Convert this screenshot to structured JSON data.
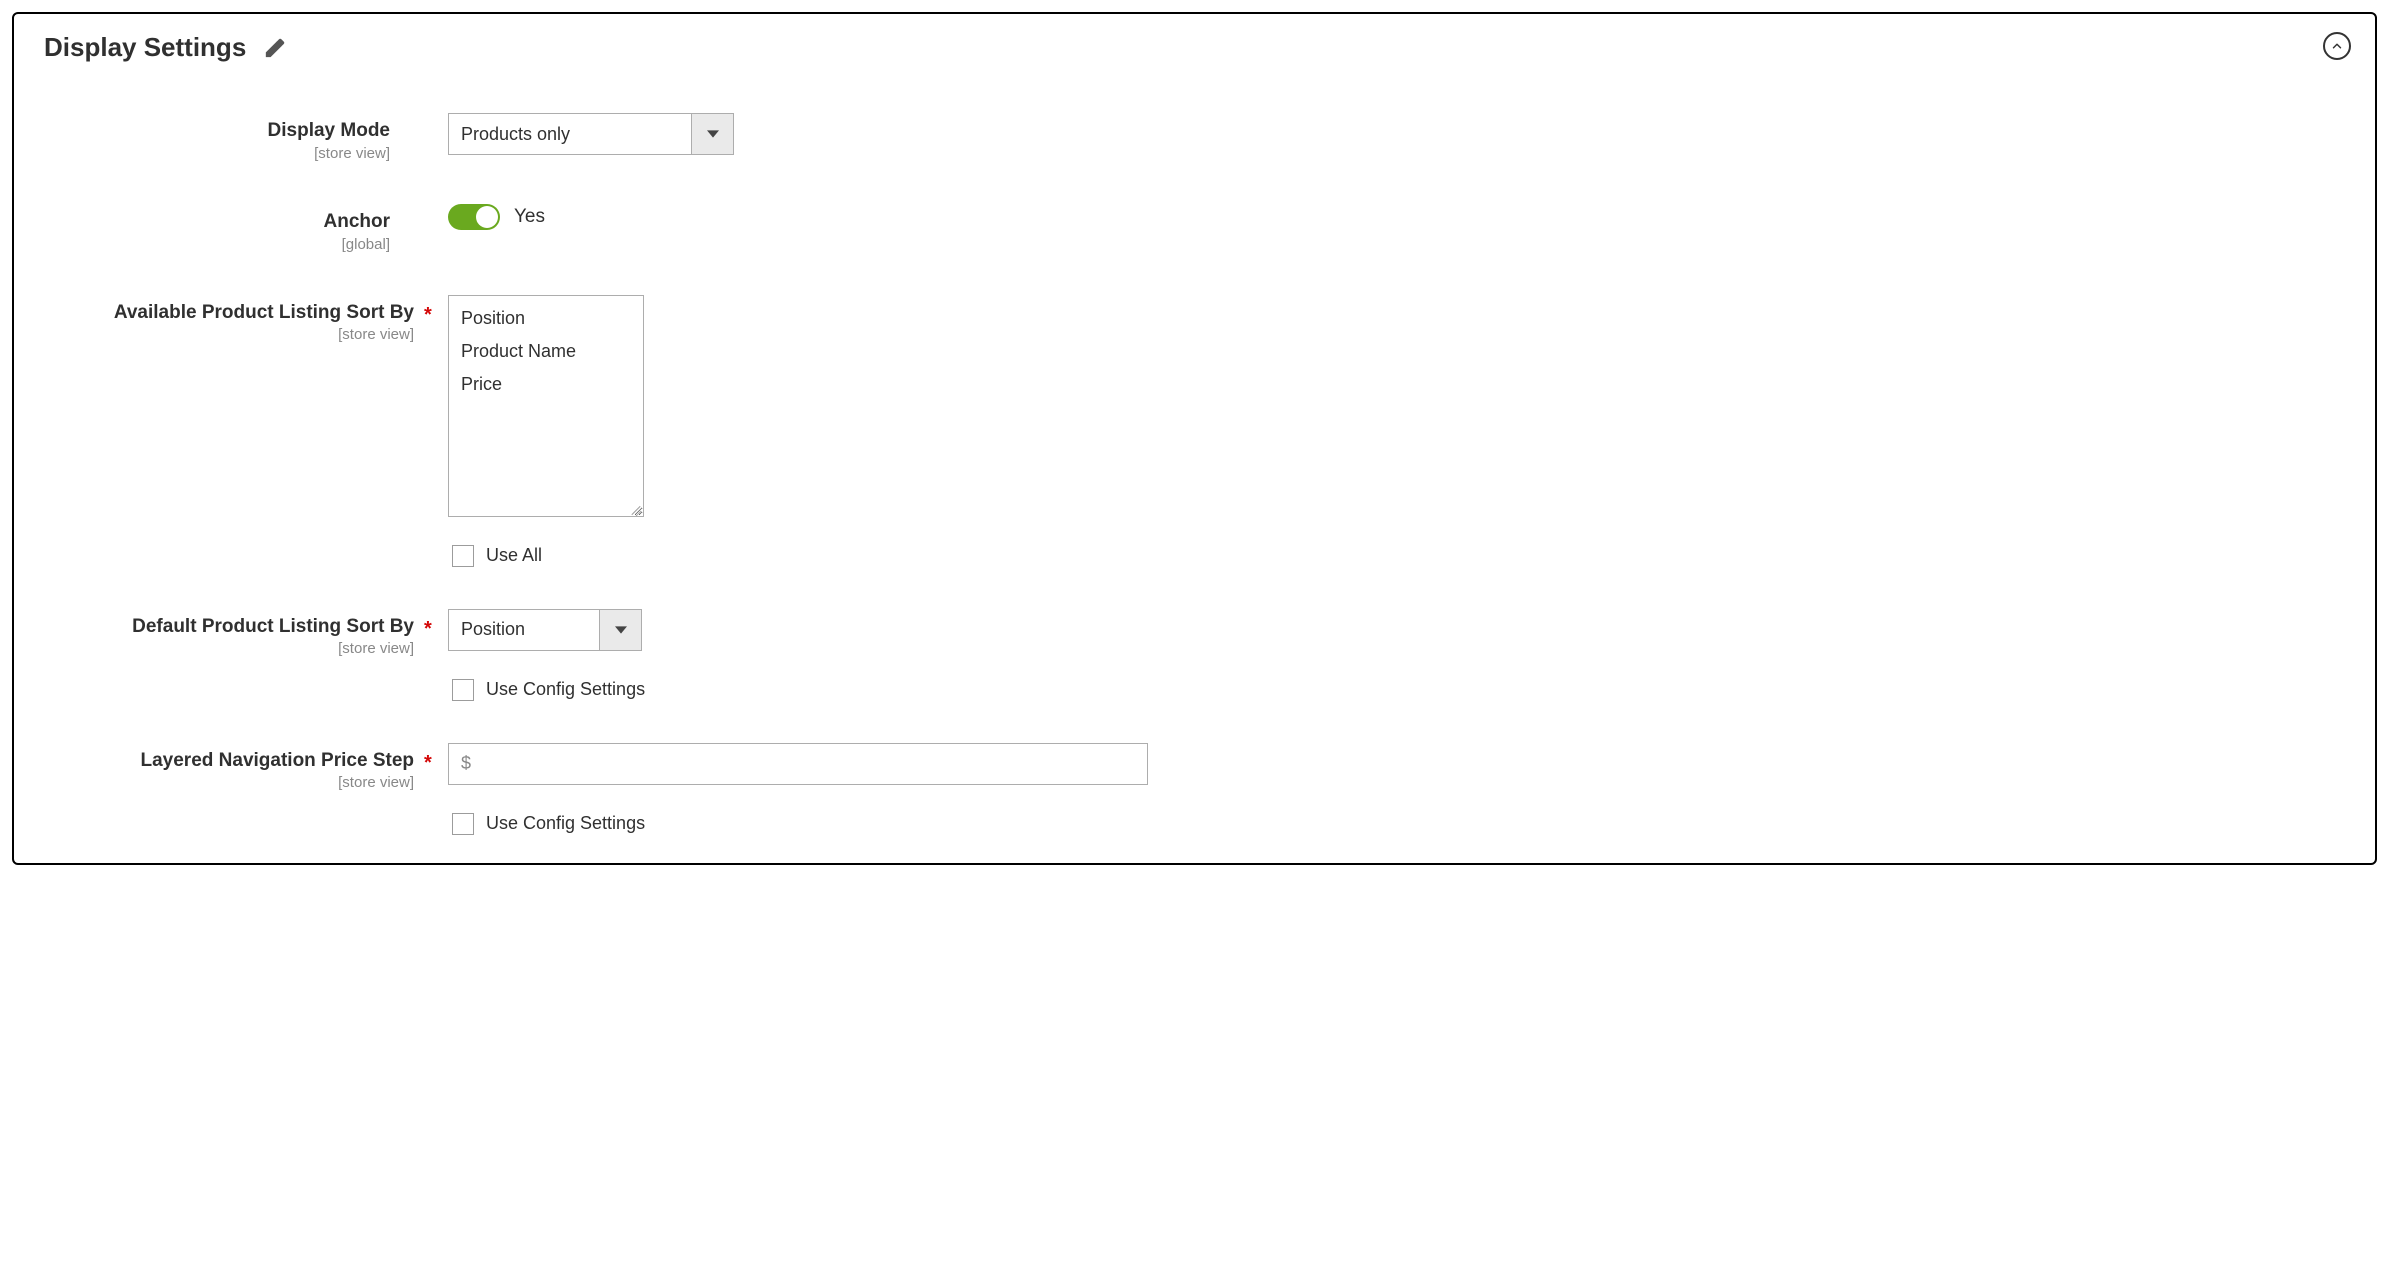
{
  "section": {
    "title": "Display Settings"
  },
  "scopes": {
    "store_view": "[store view]",
    "global": "[global]"
  },
  "fields": {
    "display_mode": {
      "label": "Display Mode",
      "value": "Products only"
    },
    "anchor": {
      "label": "Anchor",
      "value_text": "Yes"
    },
    "available_sort_by": {
      "label": "Available Product Listing Sort By",
      "options": [
        "Position",
        "Product Name",
        "Price"
      ],
      "use_all_label": "Use All"
    },
    "default_sort_by": {
      "label": "Default Product Listing Sort By",
      "value": "Position",
      "use_config_label": "Use Config Settings"
    },
    "price_step": {
      "label": "Layered Navigation Price Step",
      "currency_prefix": "$",
      "use_config_label": "Use Config Settings"
    }
  }
}
